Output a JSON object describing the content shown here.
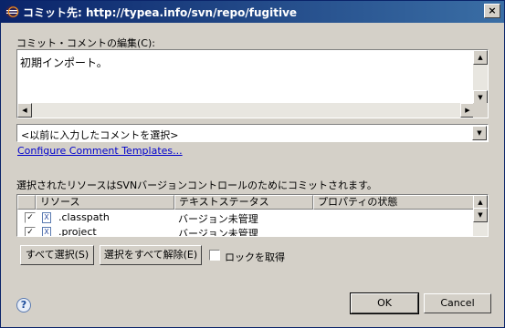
{
  "window": {
    "title": "コミット先: http://typea.info/svn/repo/fugitive",
    "close_glyph": "×"
  },
  "comment": {
    "label": "コミット・コメントの編集(C):",
    "value": "初期インポート。"
  },
  "history_combo": {
    "selected": "<以前に入力したコメントを選択>"
  },
  "configure_link": "Configure Comment Templates...",
  "resources": {
    "label": "選択されたリソースはSVNバージョンコントロールのためにコミットされます。",
    "columns": [
      "リソース",
      "テキストステータス",
      "プロパティの状態"
    ],
    "rows": [
      {
        "name": ".classpath",
        "text_status": "バージョン未管理",
        "prop_status": "",
        "checked": true
      },
      {
        "name": ".project",
        "text_status": "バージョン未管理",
        "prop_status": "",
        "checked": true
      }
    ]
  },
  "buttons": {
    "select_all": "すべて選択(S)",
    "deselect_all": "選択をすべて解除(E)",
    "lock_label": "ロックを取得",
    "ok": "OK",
    "cancel": "Cancel"
  },
  "icons": {
    "help": "?",
    "check": "✓",
    "file": "X",
    "arrow_up": "▲",
    "arrow_down": "▼",
    "arrow_left": "◀",
    "arrow_right": "▶"
  }
}
